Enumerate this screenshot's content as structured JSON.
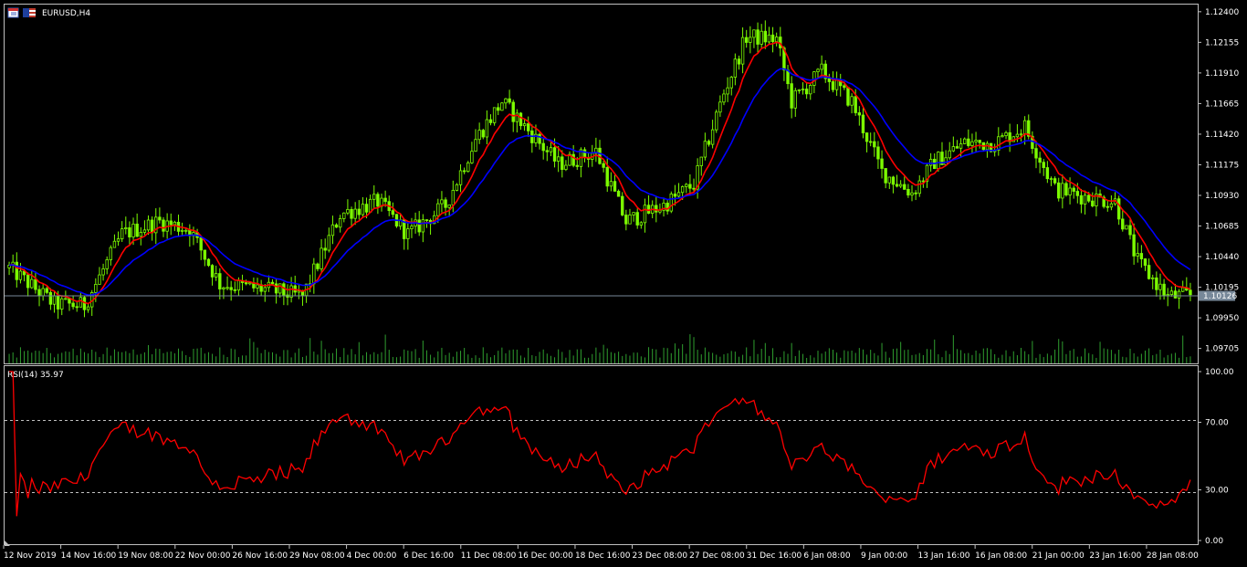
{
  "window": {
    "symbol_title": "EURUSD,H4",
    "icons": [
      "chart-window-icon",
      "flag-icon"
    ]
  },
  "colors": {
    "background": "#000000",
    "grid_frame": "#c0c0c0",
    "candle": "#7cfc00",
    "ma_fast": "#ff0000",
    "ma_slow": "#0000ff",
    "rsi_line": "#ff0000",
    "current_price_line": "#778899",
    "price_tag_bg": "#778899"
  },
  "main_panel": {
    "price_ticks": [
      "1.12400",
      "1.12155",
      "1.11910",
      "1.11665",
      "1.11420",
      "1.11175",
      "1.10930",
      "1.10685",
      "1.10440",
      "1.10195",
      "1.09950",
      "1.09705"
    ],
    "current_price": "1.10126",
    "ylim": [
      1.096,
      1.1245
    ]
  },
  "rsi_panel": {
    "label": "RSI(14) 35.97",
    "ticks": [
      "100.00",
      "70.00",
      "30.00",
      "0.00"
    ],
    "levels": [
      70,
      30
    ]
  },
  "time_axis": {
    "labels": [
      "12 Nov 2019",
      "14 Nov 16:00",
      "19 Nov 08:00",
      "22 Nov 00:00",
      "26 Nov 16:00",
      "29 Nov 08:00",
      "4 Dec 00:00",
      "6 Dec 16:00",
      "11 Dec 08:00",
      "16 Dec 00:00",
      "18 Dec 16:00",
      "23 Dec 08:00",
      "27 Dec 08:00",
      "31 Dec 16:00",
      "6 Jan 08:00",
      "9 Jan 00:00",
      "13 Jan 16:00",
      "16 Jan 08:00",
      "21 Jan 00:00",
      "23 Jan 16:00",
      "28 Jan 08:00"
    ]
  },
  "chart_data": {
    "type": "candlestick",
    "title": "EURUSD,H4",
    "price_anchors": [
      {
        "bar": 0,
        "close": 1.1035
      },
      {
        "bar": 12,
        "close": 1.1006
      },
      {
        "bar": 20,
        "close": 1.1005
      },
      {
        "bar": 30,
        "close": 1.1062
      },
      {
        "bar": 40,
        "close": 1.1072
      },
      {
        "bar": 48,
        "close": 1.1066
      },
      {
        "bar": 56,
        "close": 1.1022
      },
      {
        "bar": 68,
        "close": 1.1018
      },
      {
        "bar": 78,
        "close": 1.1012
      },
      {
        "bar": 88,
        "close": 1.1078
      },
      {
        "bar": 98,
        "close": 1.1088
      },
      {
        "bar": 106,
        "close": 1.1062
      },
      {
        "bar": 116,
        "close": 1.1085
      },
      {
        "bar": 124,
        "close": 1.1138
      },
      {
        "bar": 131,
        "close": 1.1168
      },
      {
        "bar": 138,
        "close": 1.1145
      },
      {
        "bar": 146,
        "close": 1.1118
      },
      {
        "bar": 156,
        "close": 1.1128
      },
      {
        "bar": 164,
        "close": 1.1072
      },
      {
        "bar": 174,
        "close": 1.1085
      },
      {
        "bar": 182,
        "close": 1.1102
      },
      {
        "bar": 190,
        "close": 1.1175
      },
      {
        "bar": 196,
        "close": 1.122
      },
      {
        "bar": 204,
        "close": 1.1218
      },
      {
        "bar": 208,
        "close": 1.1168
      },
      {
        "bar": 216,
        "close": 1.1192
      },
      {
        "bar": 224,
        "close": 1.1168
      },
      {
        "bar": 232,
        "close": 1.1112
      },
      {
        "bar": 240,
        "close": 1.1095
      },
      {
        "bar": 246,
        "close": 1.112
      },
      {
        "bar": 254,
        "close": 1.1135
      },
      {
        "bar": 262,
        "close": 1.1135
      },
      {
        "bar": 270,
        "close": 1.1148
      },
      {
        "bar": 278,
        "close": 1.1098
      },
      {
        "bar": 286,
        "close": 1.1092
      },
      {
        "bar": 294,
        "close": 1.1088
      },
      {
        "bar": 300,
        "close": 1.104
      },
      {
        "bar": 308,
        "close": 1.1012
      },
      {
        "bar": 314,
        "close": 1.1013
      }
    ],
    "moving_averages": [
      {
        "name": "",
        "color": "#ff0000",
        "period": 8
      },
      {
        "name": "",
        "color": "#0000ff",
        "period": 20
      }
    ],
    "rsi_period": 14,
    "rsi_last": 35.97,
    "rsi_range": [
      0,
      100
    ]
  }
}
